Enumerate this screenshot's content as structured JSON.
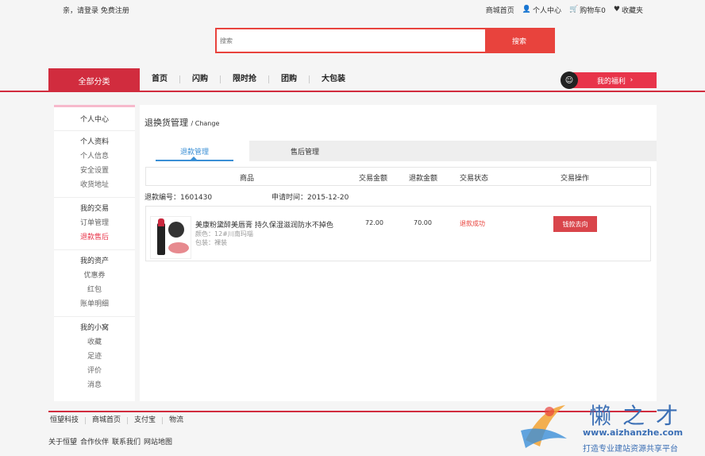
{
  "topbar": {
    "greeting": "亲，请登录",
    "register": "免费注册",
    "links": [
      "商城首页",
      "个人中心",
      "购物车0",
      "收藏夹"
    ]
  },
  "search": {
    "placeholder": "搜索",
    "button": "搜索"
  },
  "nav": {
    "all_categories": "全部分类",
    "items": [
      "首页",
      "闪购",
      "限时抢",
      "团购",
      "大包装"
    ],
    "welfare": "我的福利"
  },
  "sidebar": {
    "header": "个人中心",
    "groups": [
      {
        "title": "个人资料",
        "items": [
          "个人信息",
          "安全设置",
          "收货地址"
        ]
      },
      {
        "title": "我的交易",
        "items": [
          "订单管理",
          "退款售后"
        ]
      },
      {
        "title": "我的资产",
        "items": [
          "优惠券",
          "红包",
          "账单明细"
        ]
      },
      {
        "title": "我的小窝",
        "items": [
          "收藏",
          "足迹",
          "评价",
          "消息"
        ]
      }
    ]
  },
  "main": {
    "title": "退换货管理",
    "subtitle": "/ Change",
    "tabs": [
      "退款管理",
      "售后管理"
    ],
    "columns": [
      "商品",
      "交易金额",
      "退款金额",
      "交易状态",
      "交易操作"
    ],
    "refund_no_label": "退款编号：",
    "refund_no": "1601430",
    "apply_time_label": "申请时间：",
    "apply_time": "2015-12-20",
    "product": {
      "name": "美康粉黛醉美唇膏 持久保湿滋润防水不掉色",
      "color": "颜色：12#川南玛瑙",
      "package": "包装：裸装",
      "trade_amount": "72.00",
      "refund_amount": "70.00",
      "status": "退款成功",
      "action": "钱款去向"
    }
  },
  "footer": {
    "links": [
      "恒望科技",
      "商城首页",
      "支付宝",
      "物流"
    ],
    "links2": [
      "关于恒望",
      "合作伙伴",
      "联系我们",
      "网站地图"
    ]
  },
  "watermark": {
    "brand": "懒之才",
    "url": "www.aizhanzhe.com",
    "slogan": "打造专业建站资源共享平台"
  }
}
